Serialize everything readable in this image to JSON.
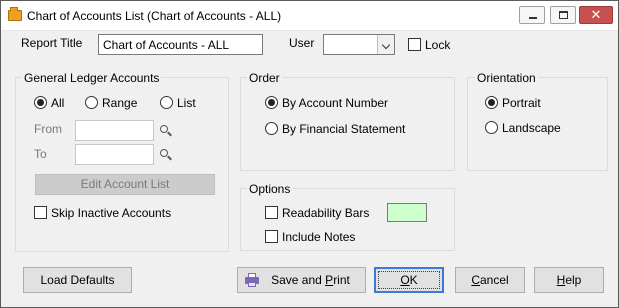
{
  "window": {
    "title": "Chart of Accounts List  (Chart of Accounts - ALL)",
    "minimize_label": "",
    "close_glyph": "✕"
  },
  "header": {
    "report_title_label": "Report Title",
    "report_title_value": "Chart of Accounts - ALL",
    "user_label": "User",
    "user_value": "",
    "lock_label": "Lock",
    "lock_checked": false
  },
  "gl_accounts": {
    "title": "General Ledger Accounts",
    "options": [
      {
        "label": "All",
        "selected": true
      },
      {
        "label": "Range",
        "selected": false
      },
      {
        "label": "List",
        "selected": false
      }
    ],
    "from_label": "From",
    "from_value": "",
    "to_label": "To",
    "to_value": "",
    "edit_list_label": "Edit Account List",
    "skip_inactive_label": "Skip Inactive Accounts",
    "skip_inactive_checked": false
  },
  "order": {
    "title": "Order",
    "options": [
      {
        "label": "By Account Number",
        "selected": true
      },
      {
        "label": "By Financial Statement",
        "selected": false
      }
    ]
  },
  "orientation": {
    "title": "Orientation",
    "options": [
      {
        "label": "Portrait",
        "selected": true
      },
      {
        "label": "Landscape",
        "selected": false
      }
    ]
  },
  "options": {
    "title": "Options",
    "readability_label": "Readability Bars",
    "readability_checked": false,
    "readability_color": "#ccffcc",
    "include_notes_label": "Include Notes",
    "include_notes_checked": false
  },
  "buttons": {
    "load_defaults": "Load Defaults",
    "save_print_prefix": "Save and ",
    "save_print_mnemonic": "P",
    "save_print_suffix": "rint",
    "ok_mnemonic": "O",
    "ok_rest": "K",
    "cancel_mnemonic": "C",
    "cancel_rest": "ancel",
    "help_mnemonic": "H",
    "help_rest": "elp"
  },
  "icons": {
    "app": "folder-icon",
    "lookup": "search-icon",
    "print": "printer-icon"
  }
}
